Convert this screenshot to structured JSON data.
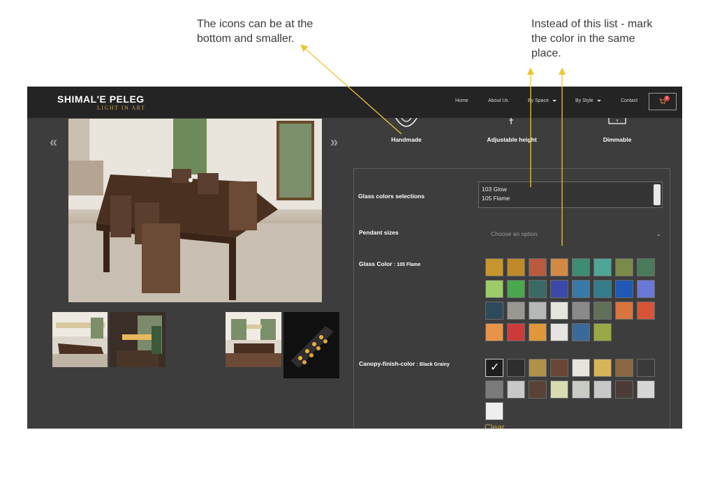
{
  "annotations": {
    "left_note": "The icons can be at the bottom and smaller.",
    "right_note": "Instead of this list - mark the color in the same place.",
    "arrow_color": "#f0c436"
  },
  "header": {
    "logo_name": "SHIMAL'E PELEG",
    "logo_tagline": "LIGHT IN ART",
    "nav": {
      "home": "Home",
      "about": "About Us",
      "by_space": "By Space",
      "by_style": "By Style",
      "contact": "Contact"
    },
    "cart_count": "0"
  },
  "gallery": {
    "prev_icon": "double-chevron-left-icon",
    "next_icon": "double-chevron-right-icon"
  },
  "features": {
    "handmade": "Handmade",
    "adjustable_height": "Adjustable height",
    "dimmable": "Dimmable"
  },
  "options": {
    "glass_colors_label": "Glass colors selections",
    "glass_colors_list": [
      "103 Glow",
      "105 Flame"
    ],
    "pendant_sizes_label": "Pendant sizes",
    "pendant_sizes_placeholder": "Choose an option",
    "glass_color_label": "Glass Color",
    "glass_color_selected": ": 105 Flame",
    "canopy_label": "Canopy-finish-color",
    "canopy_selected": ": Black Grainy",
    "clear_label": "Clear"
  },
  "glass_swatches": [
    "#c8962e",
    "#c08a2a",
    "#b85a3e",
    "#d38a45",
    "#3f8c74",
    "#4fa596",
    "#7a8a4a",
    "#4a7a5a",
    "#9ecb6a",
    "#4aa84e",
    "#3a6a66",
    "#3c49a8",
    "#3a7aa8",
    "#357c8a",
    "#2058b8",
    "#6a78d8",
    "#2e4a5a",
    "#9a9690",
    "#b6b8b8",
    "#e6e4de",
    "#8a8a8a",
    "#62705a",
    "#d8743e",
    "#d85438",
    "#e89448",
    "#cc3a3a",
    "#e0983a",
    "#e6e4e0",
    "#3a6a9a",
    "#9aa846"
  ],
  "canopy_swatches": [
    "#1e1e1e",
    "#2e2e2e",
    "#b0914a",
    "#6a4636",
    "#e6e4dc",
    "#d6b45a",
    "#8a6844",
    "#3a3a3a",
    "#7a7a7a",
    "#c8c8c8",
    "#5a4236",
    "#d8dcb0",
    "#c8ccc4",
    "#c8c8c8",
    "#4a3c36",
    "#d6d6d6",
    "#eeeeee"
  ]
}
